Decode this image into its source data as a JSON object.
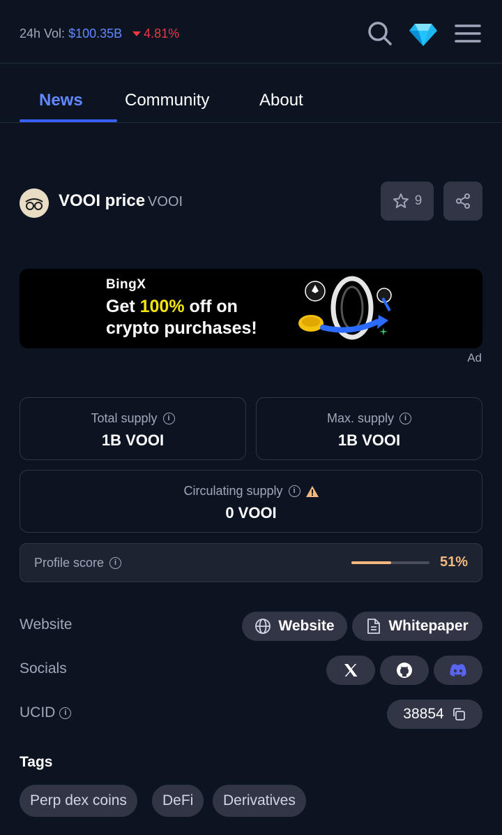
{
  "header": {
    "vol_label": "24h Vol:",
    "vol_value": "$100.35B",
    "vol_change": "4.81%",
    "icons": [
      "search-icon",
      "diamond-icon",
      "menu-icon"
    ]
  },
  "tabs": [
    {
      "label": "News",
      "active": true
    },
    {
      "label": "Community",
      "active": false
    },
    {
      "label": "About",
      "active": false
    }
  ],
  "coin": {
    "name": "VOOI price",
    "symbol": "VOOI",
    "watchlist_count": "9"
  },
  "ad": {
    "brand": "BingX",
    "line1_pre": "Get ",
    "line1_highlight": "100%",
    "line1_post": " off on",
    "line2": "crypto purchases!",
    "label": "Ad"
  },
  "supply": {
    "total_label": "Total supply",
    "total_value": "1B VOOI",
    "max_label": "Max. supply",
    "max_value": "1B VOOI",
    "circ_label": "Circulating supply",
    "circ_value": "0 VOOI"
  },
  "profile": {
    "label": "Profile score",
    "value": "51%",
    "fraction": 0.51
  },
  "links": {
    "website_label": "Website",
    "website_button": "Website",
    "whitepaper_button": "Whitepaper",
    "socials_label": "Socials",
    "socials": [
      "x-icon",
      "github-icon",
      "discord-icon"
    ],
    "ucid_label": "UCID",
    "ucid_value": "38854"
  },
  "tags": {
    "title": "Tags",
    "items": [
      "Perp dex coins",
      "DeFi",
      "Derivatives"
    ]
  },
  "colors": {
    "background": "#0d1421",
    "accent": "#6188ff",
    "negative": "#ea3943",
    "score": "#f5b97f",
    "discord": "#5865f2"
  }
}
